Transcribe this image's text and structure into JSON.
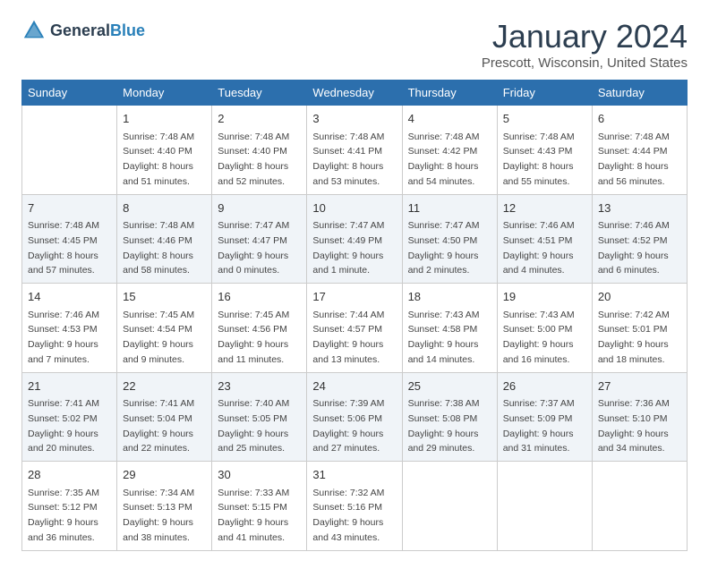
{
  "header": {
    "logo_general": "General",
    "logo_blue": "Blue",
    "month_title": "January 2024",
    "location": "Prescott, Wisconsin, United States"
  },
  "days_of_week": [
    "Sunday",
    "Monday",
    "Tuesday",
    "Wednesday",
    "Thursday",
    "Friday",
    "Saturday"
  ],
  "weeks": [
    [
      {
        "day": "",
        "sunrise": "",
        "sunset": "",
        "daylight": ""
      },
      {
        "day": "1",
        "sunrise": "Sunrise: 7:48 AM",
        "sunset": "Sunset: 4:40 PM",
        "daylight": "Daylight: 8 hours and 51 minutes."
      },
      {
        "day": "2",
        "sunrise": "Sunrise: 7:48 AM",
        "sunset": "Sunset: 4:40 PM",
        "daylight": "Daylight: 8 hours and 52 minutes."
      },
      {
        "day": "3",
        "sunrise": "Sunrise: 7:48 AM",
        "sunset": "Sunset: 4:41 PM",
        "daylight": "Daylight: 8 hours and 53 minutes."
      },
      {
        "day": "4",
        "sunrise": "Sunrise: 7:48 AM",
        "sunset": "Sunset: 4:42 PM",
        "daylight": "Daylight: 8 hours and 54 minutes."
      },
      {
        "day": "5",
        "sunrise": "Sunrise: 7:48 AM",
        "sunset": "Sunset: 4:43 PM",
        "daylight": "Daylight: 8 hours and 55 minutes."
      },
      {
        "day": "6",
        "sunrise": "Sunrise: 7:48 AM",
        "sunset": "Sunset: 4:44 PM",
        "daylight": "Daylight: 8 hours and 56 minutes."
      }
    ],
    [
      {
        "day": "7",
        "sunrise": "Sunrise: 7:48 AM",
        "sunset": "Sunset: 4:45 PM",
        "daylight": "Daylight: 8 hours and 57 minutes."
      },
      {
        "day": "8",
        "sunrise": "Sunrise: 7:48 AM",
        "sunset": "Sunset: 4:46 PM",
        "daylight": "Daylight: 8 hours and 58 minutes."
      },
      {
        "day": "9",
        "sunrise": "Sunrise: 7:47 AM",
        "sunset": "Sunset: 4:47 PM",
        "daylight": "Daylight: 9 hours and 0 minutes."
      },
      {
        "day": "10",
        "sunrise": "Sunrise: 7:47 AM",
        "sunset": "Sunset: 4:49 PM",
        "daylight": "Daylight: 9 hours and 1 minute."
      },
      {
        "day": "11",
        "sunrise": "Sunrise: 7:47 AM",
        "sunset": "Sunset: 4:50 PM",
        "daylight": "Daylight: 9 hours and 2 minutes."
      },
      {
        "day": "12",
        "sunrise": "Sunrise: 7:46 AM",
        "sunset": "Sunset: 4:51 PM",
        "daylight": "Daylight: 9 hours and 4 minutes."
      },
      {
        "day": "13",
        "sunrise": "Sunrise: 7:46 AM",
        "sunset": "Sunset: 4:52 PM",
        "daylight": "Daylight: 9 hours and 6 minutes."
      }
    ],
    [
      {
        "day": "14",
        "sunrise": "Sunrise: 7:46 AM",
        "sunset": "Sunset: 4:53 PM",
        "daylight": "Daylight: 9 hours and 7 minutes."
      },
      {
        "day": "15",
        "sunrise": "Sunrise: 7:45 AM",
        "sunset": "Sunset: 4:54 PM",
        "daylight": "Daylight: 9 hours and 9 minutes."
      },
      {
        "day": "16",
        "sunrise": "Sunrise: 7:45 AM",
        "sunset": "Sunset: 4:56 PM",
        "daylight": "Daylight: 9 hours and 11 minutes."
      },
      {
        "day": "17",
        "sunrise": "Sunrise: 7:44 AM",
        "sunset": "Sunset: 4:57 PM",
        "daylight": "Daylight: 9 hours and 13 minutes."
      },
      {
        "day": "18",
        "sunrise": "Sunrise: 7:43 AM",
        "sunset": "Sunset: 4:58 PM",
        "daylight": "Daylight: 9 hours and 14 minutes."
      },
      {
        "day": "19",
        "sunrise": "Sunrise: 7:43 AM",
        "sunset": "Sunset: 5:00 PM",
        "daylight": "Daylight: 9 hours and 16 minutes."
      },
      {
        "day": "20",
        "sunrise": "Sunrise: 7:42 AM",
        "sunset": "Sunset: 5:01 PM",
        "daylight": "Daylight: 9 hours and 18 minutes."
      }
    ],
    [
      {
        "day": "21",
        "sunrise": "Sunrise: 7:41 AM",
        "sunset": "Sunset: 5:02 PM",
        "daylight": "Daylight: 9 hours and 20 minutes."
      },
      {
        "day": "22",
        "sunrise": "Sunrise: 7:41 AM",
        "sunset": "Sunset: 5:04 PM",
        "daylight": "Daylight: 9 hours and 22 minutes."
      },
      {
        "day": "23",
        "sunrise": "Sunrise: 7:40 AM",
        "sunset": "Sunset: 5:05 PM",
        "daylight": "Daylight: 9 hours and 25 minutes."
      },
      {
        "day": "24",
        "sunrise": "Sunrise: 7:39 AM",
        "sunset": "Sunset: 5:06 PM",
        "daylight": "Daylight: 9 hours and 27 minutes."
      },
      {
        "day": "25",
        "sunrise": "Sunrise: 7:38 AM",
        "sunset": "Sunset: 5:08 PM",
        "daylight": "Daylight: 9 hours and 29 minutes."
      },
      {
        "day": "26",
        "sunrise": "Sunrise: 7:37 AM",
        "sunset": "Sunset: 5:09 PM",
        "daylight": "Daylight: 9 hours and 31 minutes."
      },
      {
        "day": "27",
        "sunrise": "Sunrise: 7:36 AM",
        "sunset": "Sunset: 5:10 PM",
        "daylight": "Daylight: 9 hours and 34 minutes."
      }
    ],
    [
      {
        "day": "28",
        "sunrise": "Sunrise: 7:35 AM",
        "sunset": "Sunset: 5:12 PM",
        "daylight": "Daylight: 9 hours and 36 minutes."
      },
      {
        "day": "29",
        "sunrise": "Sunrise: 7:34 AM",
        "sunset": "Sunset: 5:13 PM",
        "daylight": "Daylight: 9 hours and 38 minutes."
      },
      {
        "day": "30",
        "sunrise": "Sunrise: 7:33 AM",
        "sunset": "Sunset: 5:15 PM",
        "daylight": "Daylight: 9 hours and 41 minutes."
      },
      {
        "day": "31",
        "sunrise": "Sunrise: 7:32 AM",
        "sunset": "Sunset: 5:16 PM",
        "daylight": "Daylight: 9 hours and 43 minutes."
      },
      {
        "day": "",
        "sunrise": "",
        "sunset": "",
        "daylight": ""
      },
      {
        "day": "",
        "sunrise": "",
        "sunset": "",
        "daylight": ""
      },
      {
        "day": "",
        "sunrise": "",
        "sunset": "",
        "daylight": ""
      }
    ]
  ]
}
